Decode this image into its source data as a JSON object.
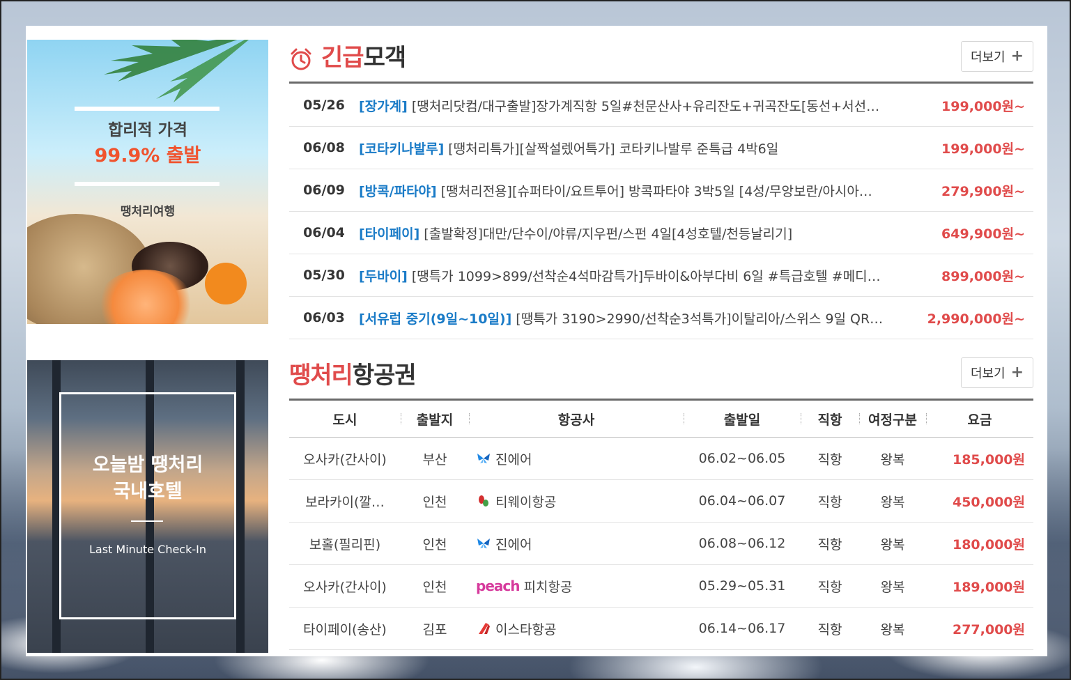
{
  "banners": {
    "promo": {
      "line1": "합리적 가격",
      "line2": "99.9% 출발",
      "brand": "땡처리여행"
    },
    "hotel": {
      "line1": "오늘밤 땡처리",
      "line2": "국내호텔",
      "sub": "Last Minute Check-In"
    }
  },
  "urgent": {
    "title_red": "긴급",
    "title_rest": "모객",
    "more_label": "더보기",
    "items": [
      {
        "date": "05/26",
        "category": "[장가계]",
        "text": "[땡처리닷컴/대구출발]장가계직항 5일#천문산사+유리잔도+귀곡잔도[동선+서선…",
        "price": "199,000원~"
      },
      {
        "date": "06/08",
        "category": "[코타키나발루]",
        "text": "[땡처리특가][살짝설렜어특가] 코타키나발루 준특급 4박6일",
        "price": "199,000원~"
      },
      {
        "date": "06/09",
        "category": "[방콕/파타야]",
        "text": "[땡처리전용][슈퍼타이/요트투어] 방콕파타야 3박5일 [4성/무앙보란/아시아…",
        "price": "279,900원~"
      },
      {
        "date": "06/04",
        "category": "[타이페이]",
        "text": "[출발확정]대만/단수이/야류/지우펀/스펀 4일[4성호텔/천등날리기]",
        "price": "649,900원~"
      },
      {
        "date": "05/30",
        "category": "[두바이]",
        "text": "[땡특가 1099>899/선착순4석마감특가]두바이&아부다비 6일 #특급호텔 #메디…",
        "price": "899,000원~"
      },
      {
        "date": "06/03",
        "category": "[서유럽 중기(9일~10일)]",
        "text": "[땡특가 3190>2990/선착순3석특가]이탈리아/스위스 9일 QR …",
        "price": "2,990,000원~"
      }
    ]
  },
  "flights": {
    "title_red": "땡처리",
    "title_rest": "항공권",
    "more_label": "더보기",
    "columns": {
      "city": "도시",
      "departure": "출발지",
      "airline": "항공사",
      "date": "출발일",
      "direct": "직항",
      "trip": "여정구분",
      "fare": "요금"
    },
    "rows": [
      {
        "city": "오사카(간사이)",
        "departure": "부산",
        "airline": "진에어",
        "logo": "jinair-icon",
        "date": "06.02~06.05",
        "direct": "직항",
        "trip": "왕복",
        "fare": "185,000원"
      },
      {
        "city": "보라카이(깔…",
        "departure": "인천",
        "airline": "티웨이항공",
        "logo": "tway-icon",
        "date": "06.04~06.07",
        "direct": "직항",
        "trip": "왕복",
        "fare": "450,000원"
      },
      {
        "city": "보홀(필리핀)",
        "departure": "인천",
        "airline": "진에어",
        "logo": "jinair-icon",
        "date": "06.08~06.12",
        "direct": "직항",
        "trip": "왕복",
        "fare": "180,000원"
      },
      {
        "city": "오사카(간사이)",
        "departure": "인천",
        "airline": "피치항공",
        "logo_text": "peach",
        "logo": "peach-icon",
        "date": "05.29~05.31",
        "direct": "직항",
        "trip": "왕복",
        "fare": "189,000원"
      },
      {
        "city": "타이페이(송산)",
        "departure": "김포",
        "airline": "이스타항공",
        "logo": "eastar-icon",
        "date": "06.14~06.17",
        "direct": "직항",
        "trip": "왕복",
        "fare": "277,000원"
      }
    ]
  },
  "colors": {
    "accent_red": "#e04b4b",
    "category_blue": "#1a7bc7"
  }
}
